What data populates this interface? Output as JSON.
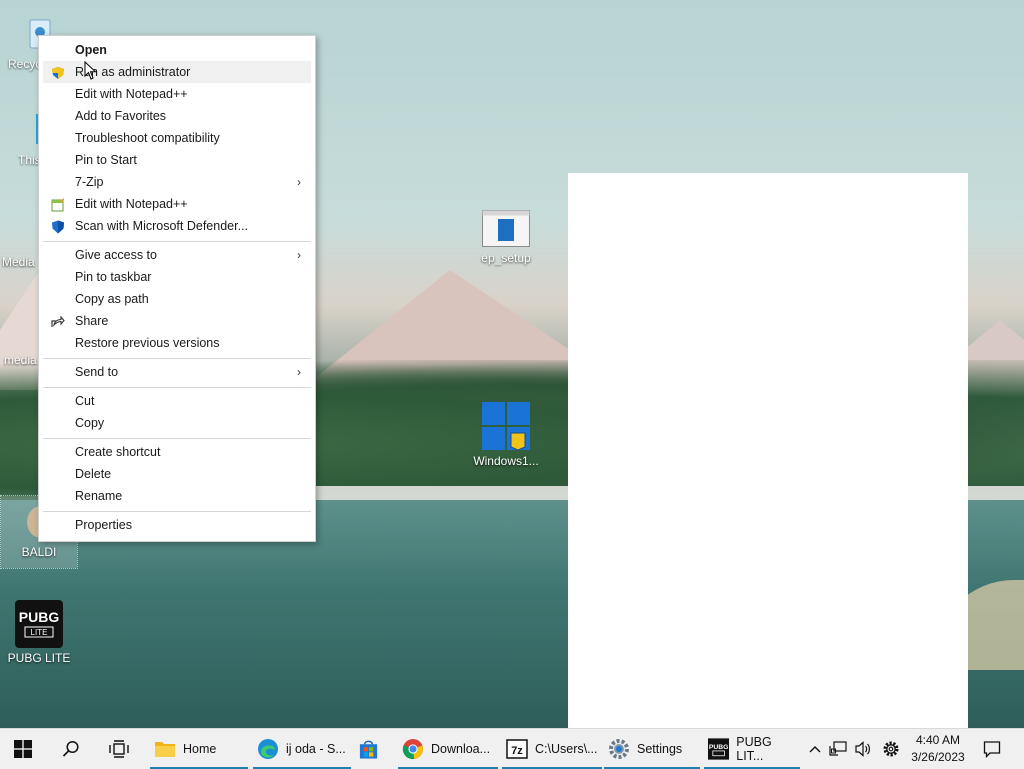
{
  "desktop": {
    "icons": [
      {
        "label": "Recyc",
        "icon": "recycle-bin-icon"
      },
      {
        "label": "This",
        "icon": "this-pc-icon"
      },
      {
        "label": "Media",
        "icon": "media-icon"
      },
      {
        "label": "media",
        "icon": "media-shortcut-icon"
      },
      {
        "label": "BALDI",
        "icon": "baldi-icon"
      },
      {
        "label": "PUBG LITE",
        "icon": "pubg-lite-icon"
      },
      {
        "label": "ep_setup",
        "icon": "installer-window-icon"
      },
      {
        "label": "Windows1...",
        "icon": "windows-logo-icon"
      }
    ]
  },
  "context_menu": {
    "items": [
      {
        "label": "Open",
        "bold": true
      },
      {
        "label": "Run as administrator",
        "icon": "uac-shield-icon",
        "hovered": true
      },
      {
        "label": "Edit with Notepad++"
      },
      {
        "label": "Add to Favorites"
      },
      {
        "label": "Troubleshoot compatibility"
      },
      {
        "label": "Pin to Start"
      },
      {
        "label": "7-Zip",
        "submenu": true
      },
      {
        "label": "Edit with Notepad++",
        "icon": "notepadpp-icon"
      },
      {
        "label": "Scan with Microsoft Defender...",
        "icon": "defender-shield-icon"
      },
      {
        "label": "Give access to",
        "submenu": true
      },
      {
        "label": "Pin to taskbar"
      },
      {
        "label": "Copy as path"
      },
      {
        "label": "Share",
        "icon": "share-icon"
      },
      {
        "label": "Restore previous versions"
      },
      {
        "label": "Send to",
        "submenu": true
      },
      {
        "label": "Cut"
      },
      {
        "label": "Copy"
      },
      {
        "label": "Create shortcut"
      },
      {
        "label": "Delete"
      },
      {
        "label": "Rename"
      },
      {
        "label": "Properties"
      }
    ],
    "submenu_arrow": "›"
  },
  "taskbar": {
    "apps": [
      {
        "label": "Home",
        "icon": "file-explorer-icon"
      },
      {
        "label": "ij oda - S...",
        "icon": "edge-icon"
      },
      {
        "label": "",
        "icon": "store-icon"
      },
      {
        "label": "Downloa...",
        "icon": "chrome-icon"
      },
      {
        "label": "C:\\Users\\...",
        "icon": "7zip-icon"
      },
      {
        "label": "Settings",
        "icon": "settings-gear-icon"
      },
      {
        "label": "PUBG LIT...",
        "icon": "pubg-icon"
      }
    ],
    "clock": {
      "time": "4:40 AM",
      "date": "3/26/2023"
    }
  },
  "colors": {
    "taskbar_bg": "#f0f0f0",
    "active_underline": "#1f7fb0",
    "menu_hover": "#f0f0f0",
    "defender_blue": "#1a6fd1",
    "uac_yellow": "#f2c318"
  }
}
